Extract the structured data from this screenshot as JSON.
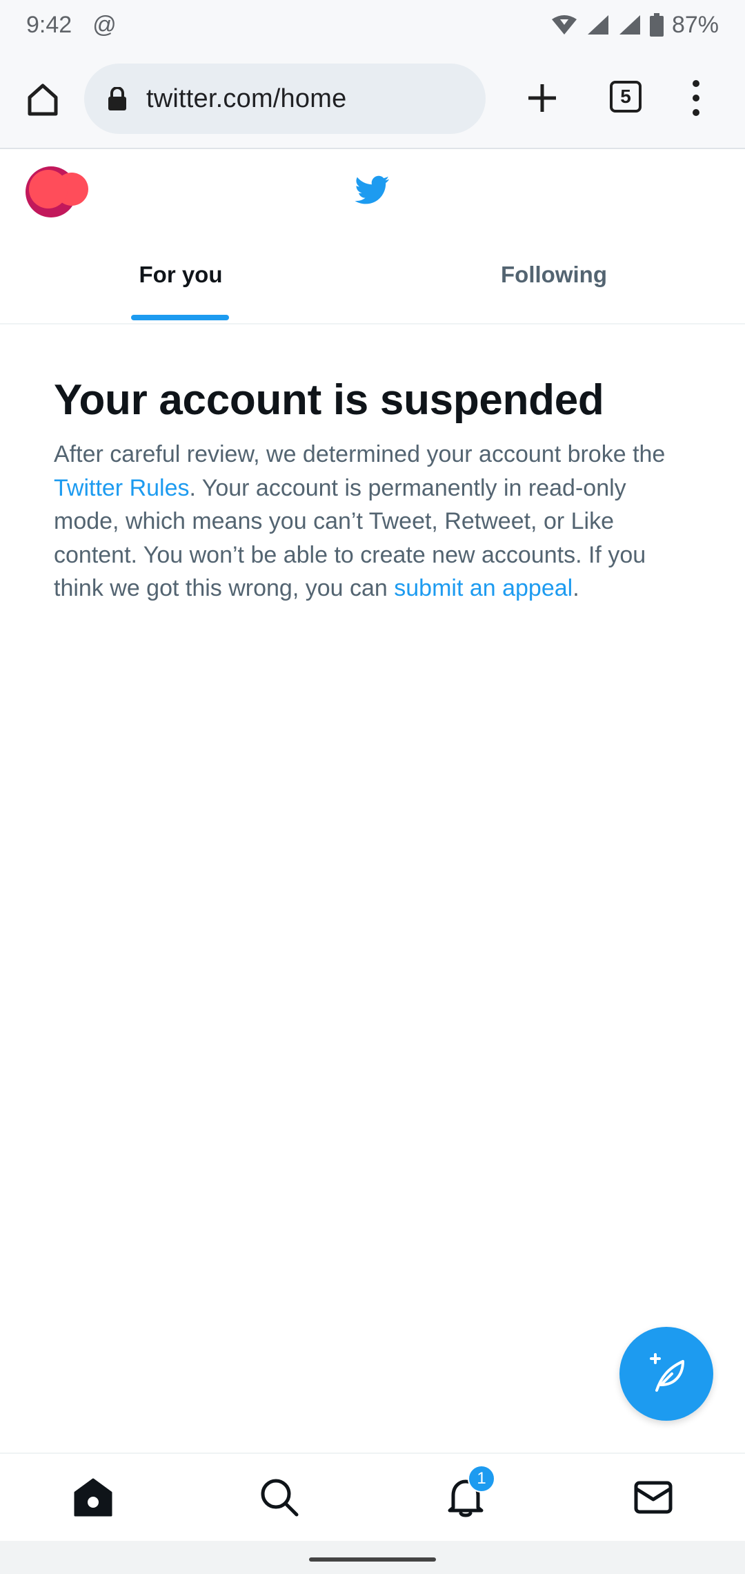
{
  "status_bar": {
    "time": "9:42",
    "at_symbol": "@",
    "battery": "87%",
    "icons": [
      "wifi-icon",
      "signal-icon",
      "signal-icon",
      "battery-icon"
    ]
  },
  "browser": {
    "url": "twitter.com/home",
    "tab_count": "5",
    "icons": [
      "home-icon",
      "lock-icon",
      "plus-icon",
      "tabs-icon",
      "menu-dots-icon"
    ]
  },
  "header": {
    "tabs": [
      {
        "label": "For you",
        "selected": true
      },
      {
        "label": "Following",
        "selected": false
      }
    ],
    "accent": "#1d9bf0"
  },
  "main": {
    "title": "Your account is suspended",
    "message": {
      "part1": "After careful review, we determined your account broke the ",
      "link1": "Twitter Rules",
      "part2": ". Your account is permanently in read-only mode, which means you can’t Tweet, Retweet, or Like content. You won’t be able to create new accounts. If you think we got this wrong, you can ",
      "link2": "submit an appeal",
      "part3": "."
    }
  },
  "bottom_nav": {
    "items": [
      "home-icon",
      "search-icon",
      "bell-icon",
      "mail-icon"
    ],
    "notification_badge": "1"
  }
}
